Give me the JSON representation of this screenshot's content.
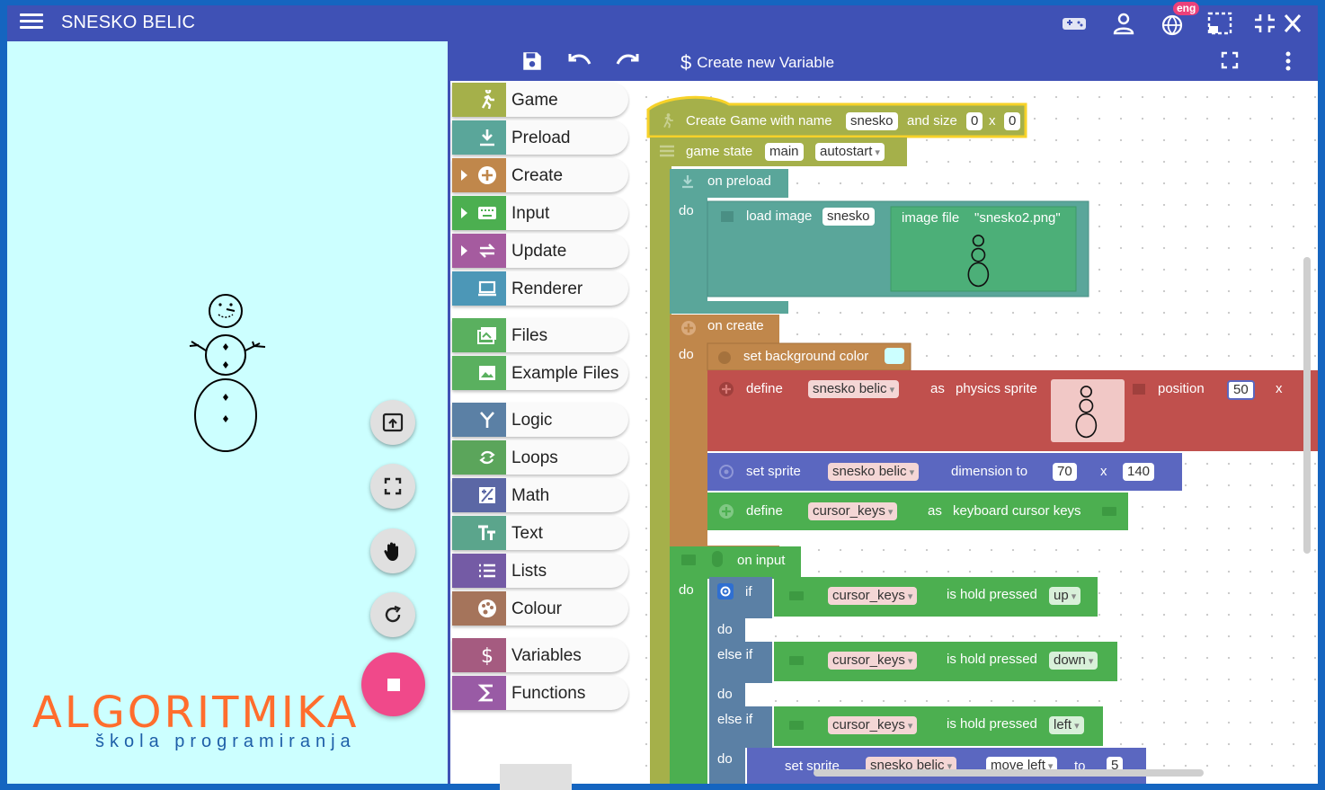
{
  "app": {
    "title": "SNESKO BELIC",
    "lang_badge": "eng"
  },
  "colors": {
    "primary": "#3f51b5",
    "stage_bg": "#ccffff",
    "accent_pink": "#f0498a",
    "logo_orange": "#ff6d2d",
    "logo_blue": "#1e5fa8"
  },
  "appbar_icons": [
    "gamepad-icon",
    "account-icon",
    "language-icon",
    "selection-icon",
    "fullscreen-exit-icon",
    "close-icon"
  ],
  "toolbar": {
    "create_variable": "Create new Variable"
  },
  "logo": {
    "word": "ALGORITMIKA",
    "tagline": "škola programiranja"
  },
  "categories": [
    {
      "label": "Game",
      "color": "#a5b04a",
      "expandable": false
    },
    {
      "label": "Preload",
      "color": "#5aa69a",
      "expandable": false
    },
    {
      "label": "Create",
      "color": "#c0874b",
      "expandable": true
    },
    {
      "label": "Input",
      "color": "#4caf50",
      "expandable": true
    },
    {
      "label": "Update",
      "color": "#a55b9f",
      "expandable": true
    },
    {
      "label": "Renderer",
      "color": "#4c97b7",
      "expandable": false
    },
    {
      "label": "Files",
      "color": "#5ab05f",
      "expandable": false
    },
    {
      "label": "Example Files",
      "color": "#5ab05f",
      "expandable": false
    },
    {
      "label": "Logic",
      "color": "#5b80a5",
      "expandable": false
    },
    {
      "label": "Loops",
      "color": "#5ba55b",
      "expandable": false
    },
    {
      "label": "Math",
      "color": "#5b67a5",
      "expandable": false
    },
    {
      "label": "Text",
      "color": "#5ba58c",
      "expandable": false
    },
    {
      "label": "Lists",
      "color": "#745ba5",
      "expandable": false
    },
    {
      "label": "Colour",
      "color": "#a5745b",
      "expandable": false
    },
    {
      "label": "Variables",
      "color": "#a55b80",
      "expandable": false
    },
    {
      "label": "Functions",
      "color": "#995ba5",
      "expandable": false
    }
  ],
  "blocks": {
    "game": {
      "label": "Create Game with name",
      "name": "snesko",
      "size_label": "and size",
      "w": "0",
      "x": "x",
      "h": "0"
    },
    "state": {
      "label": "game state",
      "name": "main",
      "mode": "autostart"
    },
    "do": "do",
    "preload": {
      "label": "on preload",
      "load": "load image",
      "key": "snesko",
      "file_label": "image file",
      "file": "\"snesko2.png\""
    },
    "create": {
      "label": "on create",
      "bg": "set background color",
      "define": "define",
      "sprite_var": "snesko belic",
      "as_label": "as",
      "physics": "physics sprite",
      "position": "position",
      "pos_x": "50",
      "x": "x",
      "set_sprite": "set sprite",
      "sprite_var2": "snesko belic",
      "dimension": "dimension to",
      "dim_w": "70",
      "dim_h": "140",
      "define2": "define",
      "keys_var": "cursor_keys",
      "as2": "as",
      "keyboard": "keyboard cursor keys"
    },
    "input": {
      "label": "on input",
      "if": "if",
      "else_if": "else if",
      "do": "do",
      "var": "cursor_keys",
      "hold": "is hold pressed",
      "up": "up",
      "down": "down",
      "left": "left",
      "set_sprite": "set sprite",
      "sprite": "snesko belic",
      "move": "move left",
      "to": "to",
      "speed": "5"
    }
  }
}
